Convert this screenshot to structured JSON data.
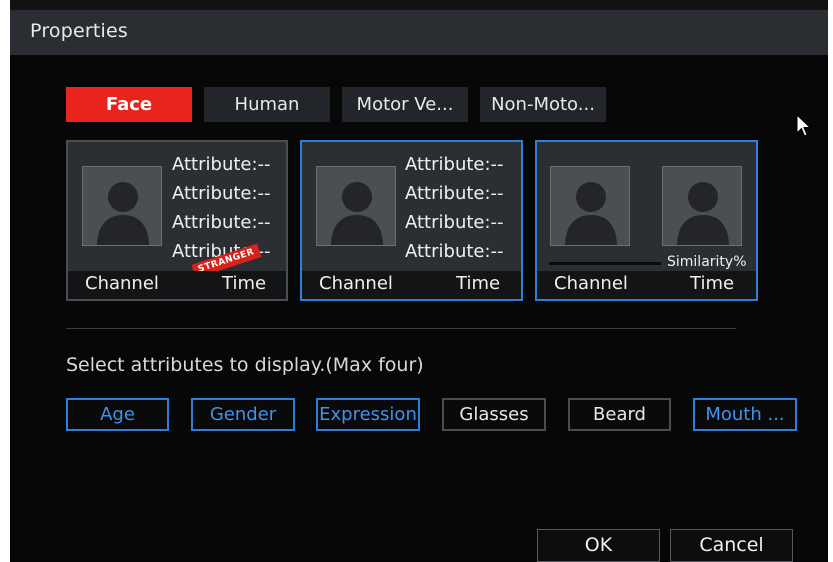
{
  "dialog": {
    "title": "Properties"
  },
  "tabs": [
    {
      "label": "Face",
      "active": true
    },
    {
      "label": "Human",
      "active": false
    },
    {
      "label": "Motor Ve...",
      "active": false
    },
    {
      "label": "Non-Moto...",
      "active": false
    }
  ],
  "cards": [
    {
      "attributes": [
        "Attribute:--",
        "Attribute:--",
        "Attribute:--",
        "Attribute:--"
      ],
      "stamp": "STRANGER",
      "channel": "Channel",
      "time": "Time"
    },
    {
      "attributes": [
        "Attribute:--",
        "Attribute:--",
        "Attribute:--",
        "Attribute:--"
      ],
      "channel": "Channel",
      "time": "Time"
    },
    {
      "similarity": "Similarity%",
      "channel": "Channel",
      "time": "Time"
    }
  ],
  "instruction": "Select attributes to display.(Max four)",
  "attribute_options": [
    {
      "label": "Age",
      "selected": true
    },
    {
      "label": "Gender",
      "selected": true
    },
    {
      "label": "Expression",
      "selected": true
    },
    {
      "label": "Glasses",
      "selected": false
    },
    {
      "label": "Beard",
      "selected": false
    },
    {
      "label": "Mouth ...",
      "selected": true
    }
  ],
  "buttons": {
    "ok": "OK",
    "cancel": "Cancel"
  },
  "colors": {
    "accent_red": "#e8241c",
    "selected_blue": "#2f7fd6",
    "background": "#070707"
  }
}
